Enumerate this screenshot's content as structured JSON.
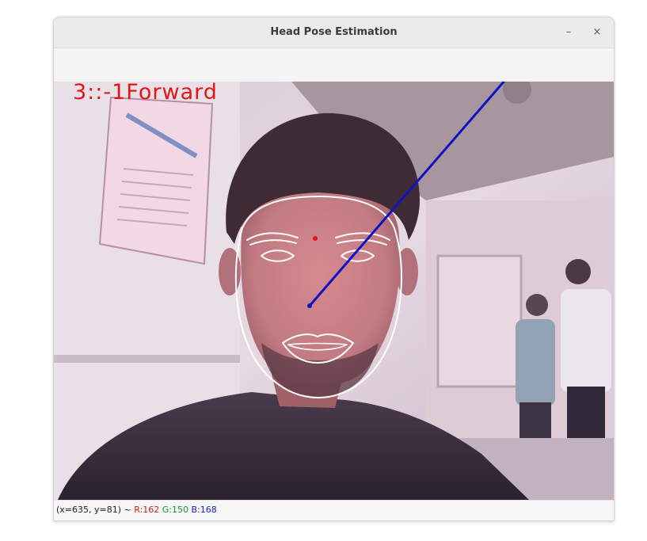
{
  "window": {
    "title": "Head Pose Estimation",
    "minimize_glyph": "–",
    "close_glyph": "×"
  },
  "overlay": {
    "pose_label": "3::-1Forward",
    "label_color": "#e21616",
    "pose_line_color": "#1010c8",
    "landmark_color": "#ffffff"
  },
  "status": {
    "coords": "(x=635, y=81) ~",
    "r": "R:162",
    "g": "G:150",
    "b": "B:168",
    "r_color": "#d11c1c",
    "g_color": "#1a9a1a",
    "b_color": "#1a1ad1"
  }
}
